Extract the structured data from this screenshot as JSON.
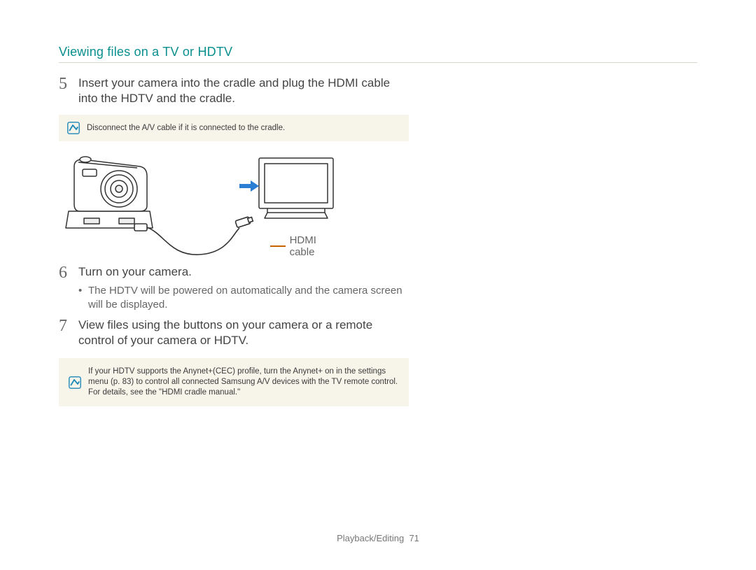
{
  "header": {
    "title": "Viewing files on a TV or HDTV"
  },
  "steps": [
    {
      "num": "5",
      "text": "Insert your camera into the cradle and plug the HDMI cable into the HDTV and the cradle."
    },
    {
      "num": "6",
      "text": "Turn on your camera.",
      "sub": [
        "The HDTV will be powered on automatically and the camera screen will be displayed."
      ]
    },
    {
      "num": "7",
      "text": "View files using the buttons on your camera or a remote control of your camera or HDTV."
    }
  ],
  "notes": {
    "note1": "Disconnect the A/V cable if it is connected to the cradle.",
    "note2": "If your HDTV supports the Anynet+(CEC) profile, turn the Anynet+ on in the settings menu (p. 83) to control all connected Samsung A/V devices with the TV remote control. For details, see the \"HDMI cradle manual.\""
  },
  "diagram": {
    "hdmi_label": "HDMI cable"
  },
  "footer": {
    "section": "Playback/Editing",
    "page": "71"
  }
}
